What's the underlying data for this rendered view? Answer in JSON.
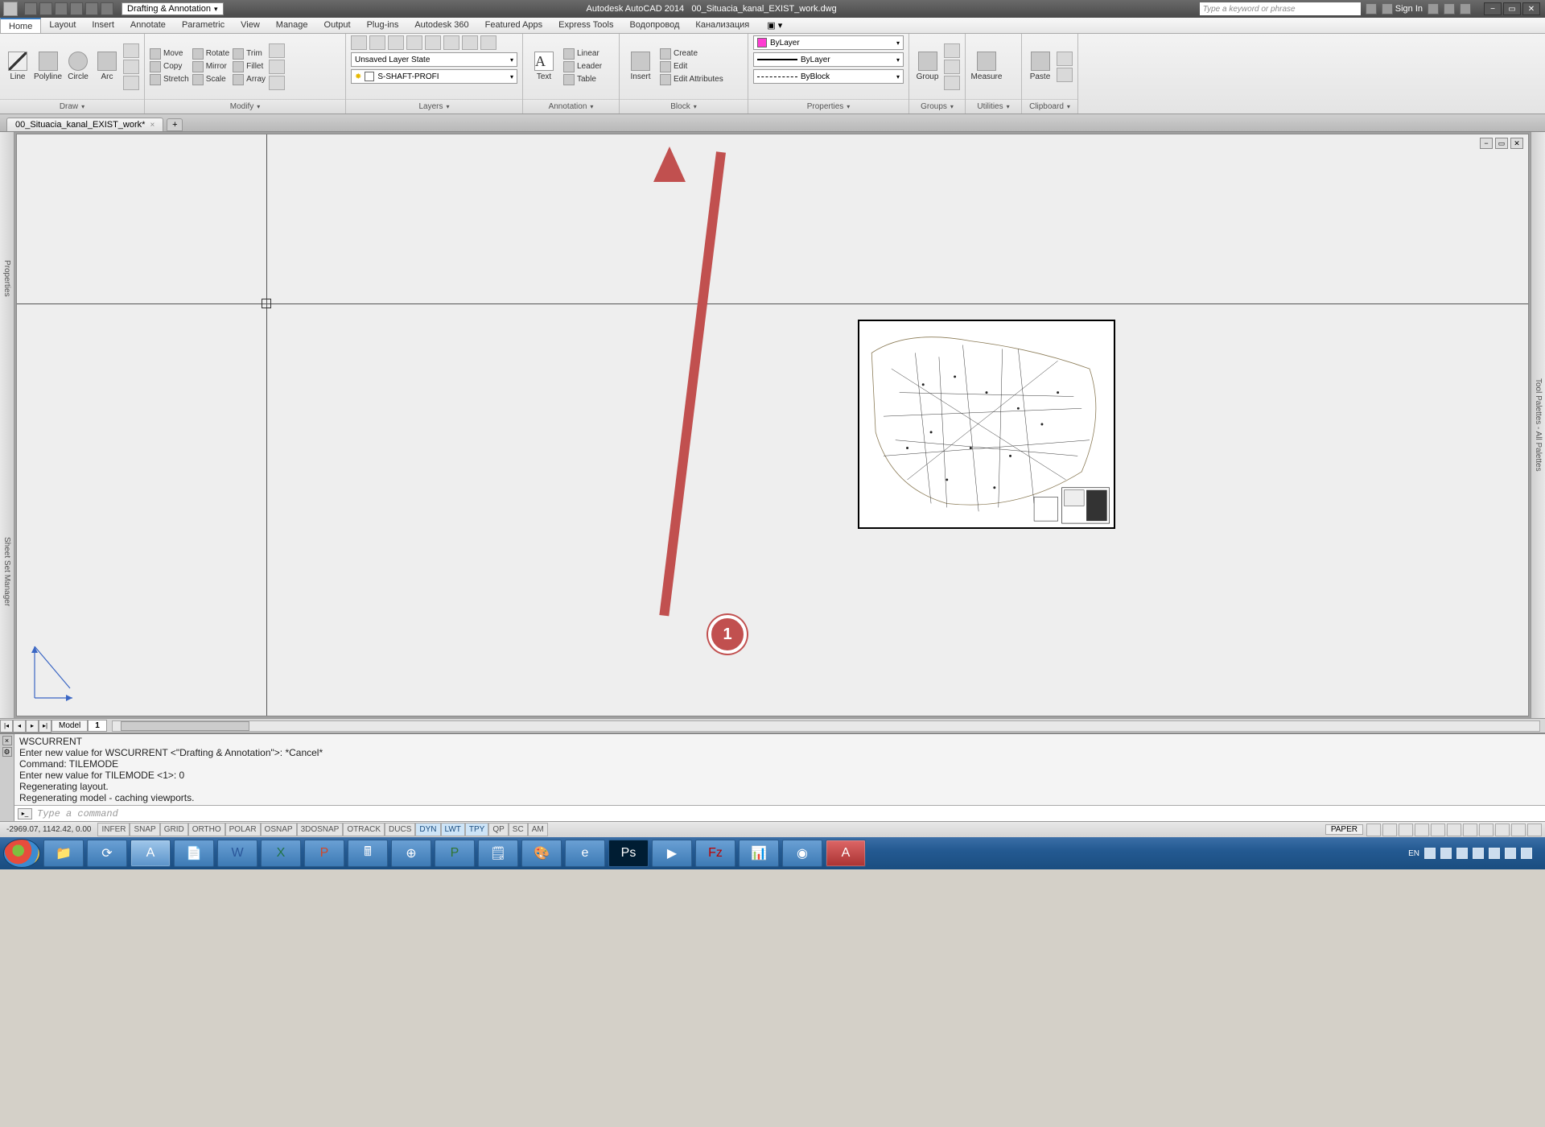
{
  "title": {
    "app": "Autodesk AutoCAD 2014",
    "file": "00_Situacia_kanal_EXIST_work.dwg"
  },
  "workspace": "Drafting & Annotation",
  "search_placeholder": "Type a keyword or phrase",
  "signin": "Sign In",
  "menu": [
    "Home",
    "Layout",
    "Insert",
    "Annotate",
    "Parametric",
    "View",
    "Manage",
    "Output",
    "Plug-ins",
    "Autodesk 360",
    "Featured Apps",
    "Express Tools",
    "Водопровод",
    "Канализация"
  ],
  "menu_active": 0,
  "ribbon": {
    "draw": {
      "title": "Draw",
      "items": [
        "Line",
        "Polyline",
        "Circle",
        "Arc"
      ]
    },
    "modify": {
      "title": "Modify",
      "rows": [
        [
          "Move",
          "Rotate",
          "Trim"
        ],
        [
          "Copy",
          "Mirror",
          "Fillet"
        ],
        [
          "Stretch",
          "Scale",
          "Array"
        ]
      ]
    },
    "layers": {
      "title": "Layers",
      "state": "Unsaved Layer State",
      "current": "S-SHAFT-PROFI",
      "swatch": "#ff3cd2"
    },
    "annotation": {
      "title": "Annotation",
      "text": "Text",
      "rows": [
        "Linear",
        "Leader",
        "Table"
      ]
    },
    "block": {
      "title": "Block",
      "insert": "Insert",
      "rows": [
        "Create",
        "Edit",
        "Edit Attributes"
      ]
    },
    "properties": {
      "title": "Properties",
      "color": "ByLayer",
      "swatch": "#ff3cd2",
      "lw": "ByLayer",
      "lt": "ByBlock"
    },
    "groups": {
      "title": "Groups",
      "label": "Group"
    },
    "utilities": {
      "title": "Utilities",
      "label": "Measure"
    },
    "clipboard": {
      "title": "Clipboard",
      "label": "Paste"
    }
  },
  "doctab": "00_Situacia_kanal_EXIST_work*",
  "palettes": {
    "left": "Properties",
    "left2": "Sheet Set Manager",
    "right": "Tool Palettes - All Palettes"
  },
  "layout": {
    "tabs": [
      "Model",
      "1"
    ],
    "active": 1
  },
  "annotation": {
    "badge": "1"
  },
  "command": {
    "history": "WSCURRENT\nEnter new value for WSCURRENT <\"Drafting & Annotation\">: *Cancel*\nCommand: TILEMODE\nEnter new value for TILEMODE <1>: 0\nRegenerating layout.\nRegenerating model - caching viewports.",
    "placeholder": "Type a command"
  },
  "status": {
    "coords": "-2969.07, 1142.42, 0.00",
    "toggles": [
      "INFER",
      "SNAP",
      "GRID",
      "ORTHO",
      "POLAR",
      "OSNAP",
      "3DOSNAP",
      "OTRACK",
      "DUCS",
      "DYN",
      "LWT",
      "TPY",
      "QP",
      "SC",
      "AM"
    ],
    "toggles_on": [
      9,
      10,
      11
    ],
    "paper": "PAPER"
  },
  "tray": {
    "lang": "EN",
    "time": "",
    "date": ""
  }
}
